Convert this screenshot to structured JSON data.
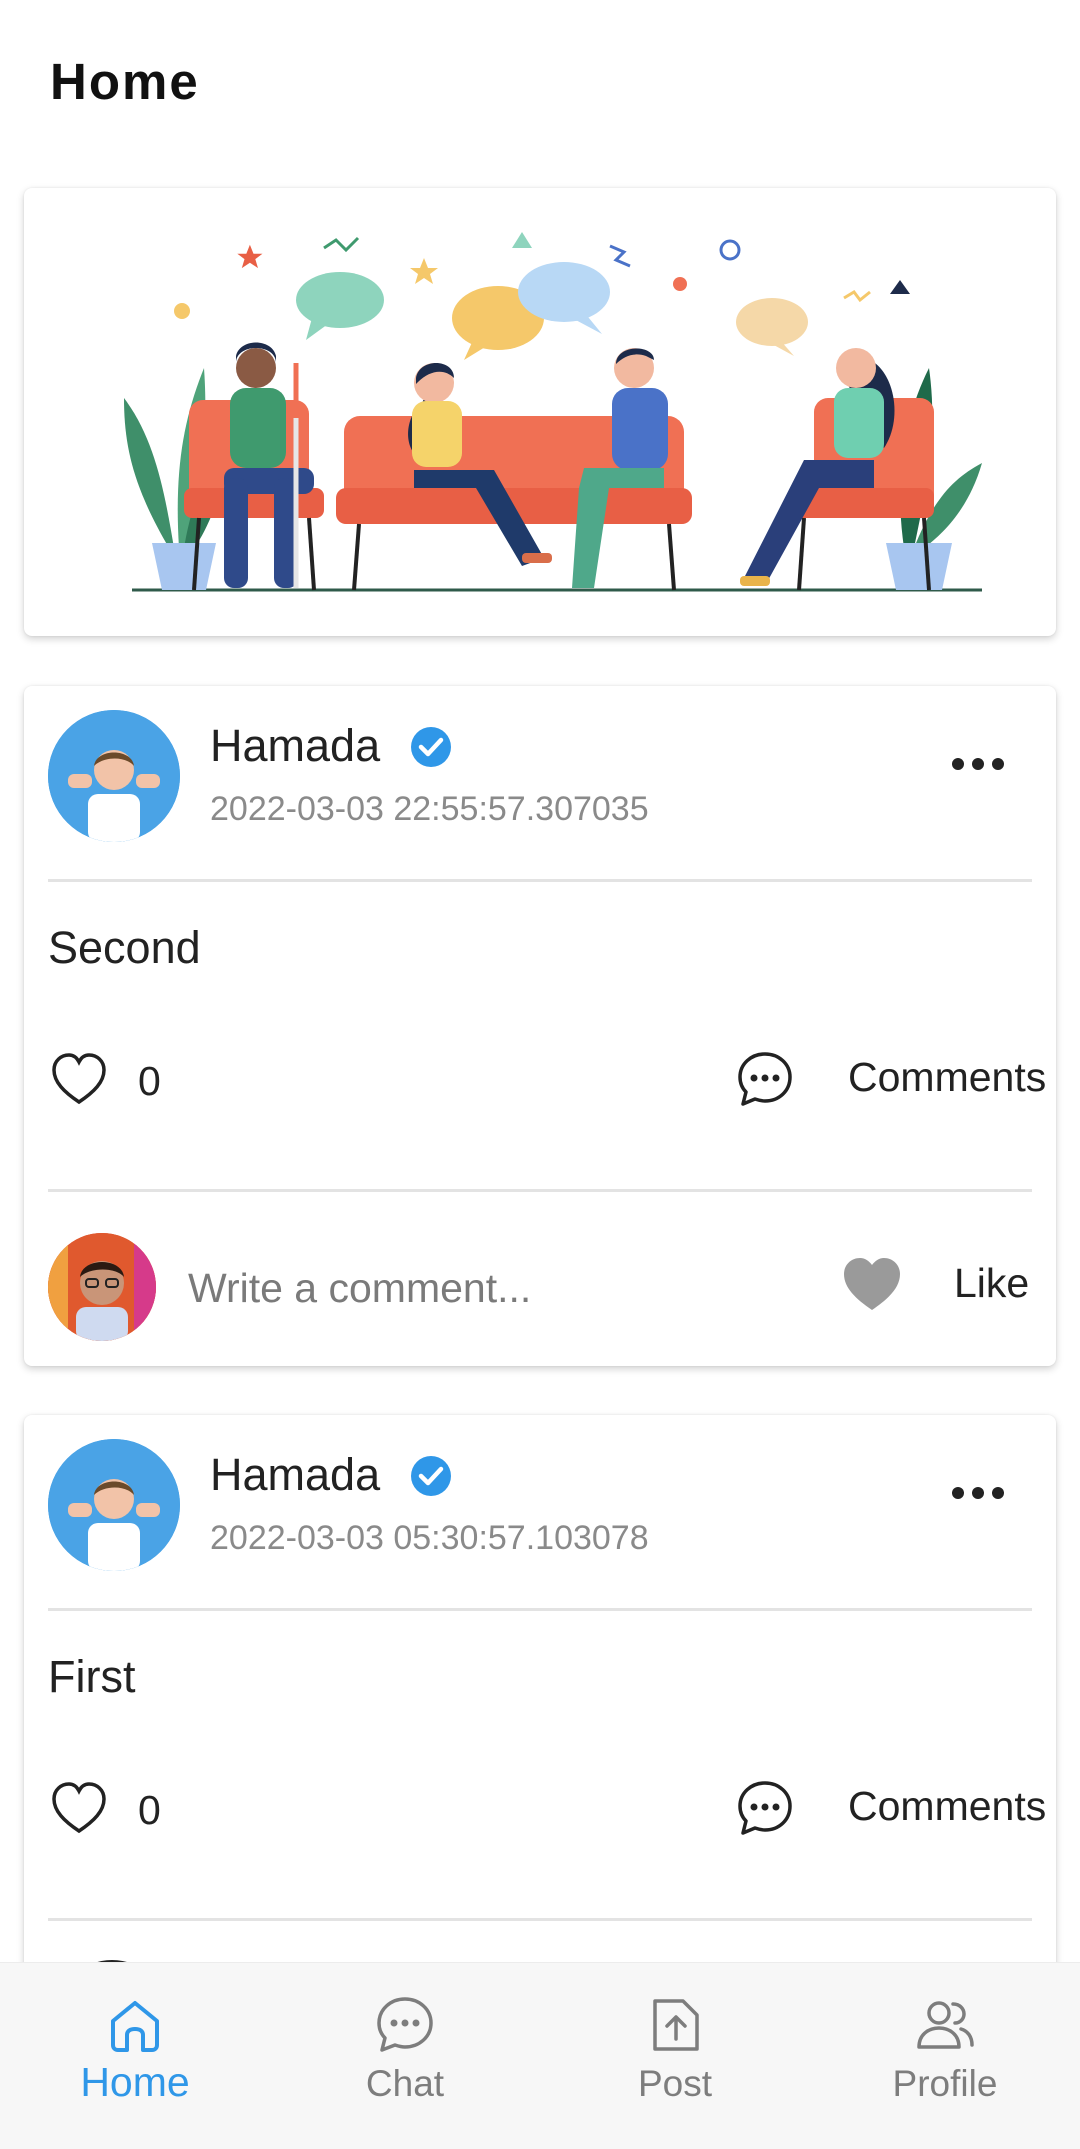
{
  "header": {
    "title": "Home"
  },
  "posts": [
    {
      "author": "Hamada",
      "verified": true,
      "timestamp": "2022-03-03 22:55:57.307035",
      "text": "Second",
      "likes": "0",
      "comments_label": "Comments",
      "comment_placeholder": "Write a comment...",
      "like_label": "Like"
    },
    {
      "author": "Hamada",
      "verified": true,
      "timestamp": "2022-03-03 05:30:57.103078",
      "text": "First",
      "likes": "0",
      "comments_label": "Comments"
    }
  ],
  "nav": {
    "items": [
      {
        "label": "Home",
        "icon": "home-icon",
        "active": true
      },
      {
        "label": "Chat",
        "icon": "chat-icon",
        "active": false
      },
      {
        "label": "Post",
        "icon": "upload-file-icon",
        "active": false
      },
      {
        "label": "Profile",
        "icon": "users-icon",
        "active": false
      }
    ]
  },
  "colors": {
    "accent": "#2f97e8",
    "verified": "#2f97e8",
    "muted_text": "#8a8a8a",
    "divider": "#e3e3e3",
    "nav_background": "#f7f7f7"
  }
}
